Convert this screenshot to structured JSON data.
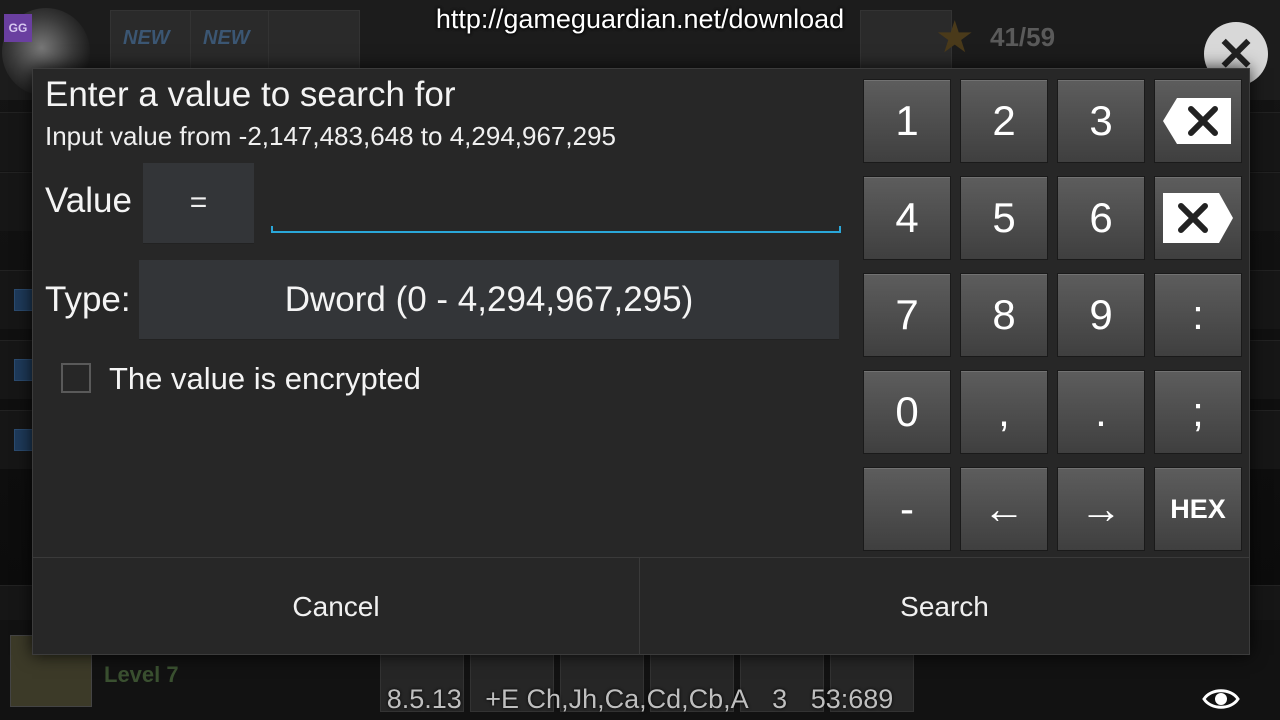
{
  "overlay": {
    "url": "http://gameguardian.net/download"
  },
  "background": {
    "gg_badge": "GG",
    "new_label": "NEW",
    "counter": "41/59",
    "level": "Level 7"
  },
  "dialog": {
    "title": "Enter a value to search for",
    "hint": "Input value from -2,147,483,648 to 4,294,967,295",
    "value_label": "Value",
    "operator": "=",
    "value_input": "",
    "type_label": "Type:",
    "type_value": "Dword (0 - 4,294,967,295)",
    "encrypted_label": "The value is encrypted",
    "encrypted_checked": false,
    "cancel_label": "Cancel",
    "search_label": "Search",
    "accent_color": "#2aa7d9"
  },
  "keypad": {
    "keys": [
      "1",
      "2",
      "3",
      "4",
      "5",
      "6",
      "7",
      "8",
      "9",
      ":",
      "0",
      ",",
      ".",
      ";",
      "-",
      "←",
      "→",
      "HEX"
    ],
    "backspace_icons": [
      "backspace-icon",
      "backspace-icon"
    ]
  },
  "status_bar": {
    "version": "8.5.13",
    "flags": "+E Ch,Jh,Ca,Cd,Cb,A",
    "count": "3",
    "pid": "53:689"
  }
}
